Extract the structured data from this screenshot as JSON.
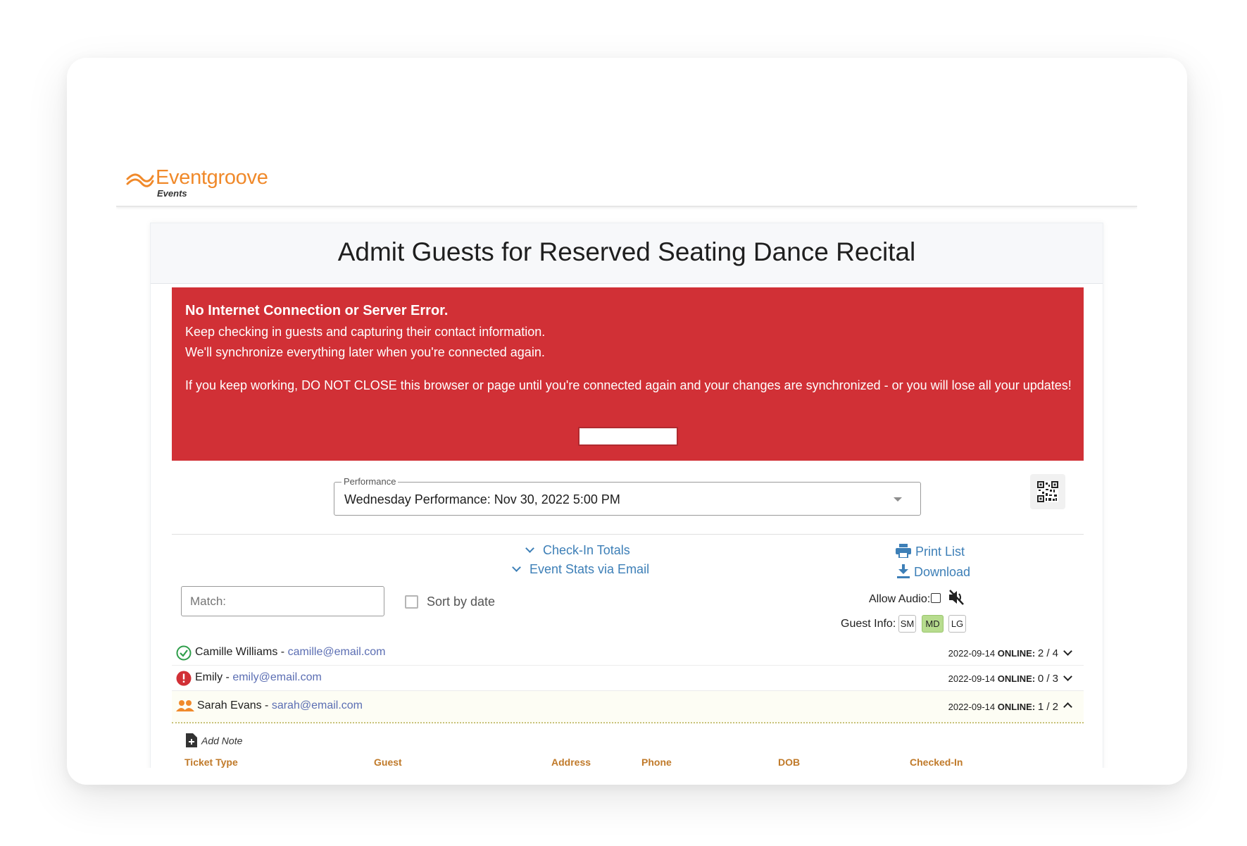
{
  "brand": {
    "name": "Eventgroove",
    "sub": "Events",
    "color": "#f0892a"
  },
  "page": {
    "title": "Admit Guests for Reserved Seating Dance Recital"
  },
  "error": {
    "color": "#d13036",
    "title": "No Internet Connection or Server Error.",
    "line1": "Keep checking in guests and capturing their contact information.",
    "line2": "We'll synchronize everything later when you're connected again.",
    "line3": "If you keep working, DO NOT CLOSE this browser or page until you're connected again and your changes are synchronized - or you will lose all your updates!"
  },
  "performance": {
    "legend": "Performance",
    "value": "Wednesday Performance: Nov 30, 2022 5:00 PM"
  },
  "links": {
    "checkin_totals": "Check-In Totals",
    "event_stats": "Event Stats via Email",
    "print_list": "Print List",
    "download": "Download",
    "color": "#3d7fb7"
  },
  "filters": {
    "match_placeholder": "Match:",
    "sort_label": "Sort by date",
    "allow_audio": "Allow Audio:",
    "guest_info": "Guest Info:",
    "sizes": [
      "SM",
      "MD",
      "LG"
    ],
    "selected_size": "MD"
  },
  "guests": [
    {
      "name": "Camille Williams",
      "sep": " - ",
      "email": "camille@email.com",
      "date": "2022-09-14",
      "status_label": "ONLINE:",
      "count": "2 / 4",
      "icon": "check-circle-icon",
      "expanded": false
    },
    {
      "name": "Emily",
      "sep": " - ",
      "email": "emily@email.com",
      "date": "2022-09-14",
      "status_label": "ONLINE:",
      "count": "0 / 3",
      "icon": "alert-circle-icon",
      "expanded": false
    },
    {
      "name": "Sarah Evans",
      "sep": " - ",
      "email": "sarah@email.com",
      "date": "2022-09-14",
      "status_label": "ONLINE:",
      "count": "1 / 2",
      "icon": "group-icon",
      "expanded": true
    }
  ],
  "details": {
    "add_note": "Add Note",
    "columns": [
      "Ticket Type",
      "Guest",
      "Address",
      "Phone",
      "DOB",
      "Checked-In"
    ]
  }
}
